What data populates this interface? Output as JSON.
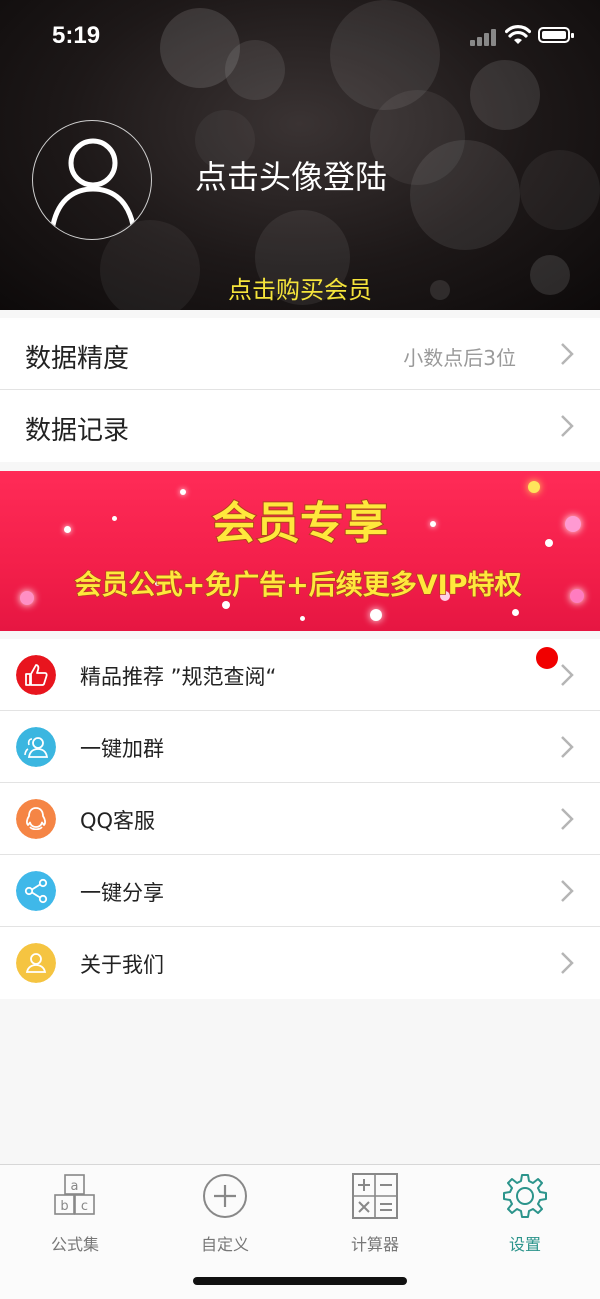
{
  "status_bar": {
    "time": "5:19"
  },
  "header": {
    "login_text": "点击头像登陆",
    "vip_link": "点击购买会员"
  },
  "settings": [
    {
      "label": "数据精度",
      "value": "小数点后3位"
    },
    {
      "label": "数据记录",
      "value": ""
    }
  ],
  "banner": {
    "title": "会员专享",
    "subtitle": "会员公式+免广告+后续更多VIP特权"
  },
  "menu": [
    {
      "label": "精品推荐 ”规范查阅“",
      "icon": "thumbs-up-icon",
      "color": "#e8151e",
      "has_badge": true
    },
    {
      "label": "一键加群",
      "icon": "group-icon",
      "color": "#3bb6e0",
      "has_badge": false
    },
    {
      "label": "QQ客服",
      "icon": "qq-icon",
      "color": "#f58545",
      "has_badge": false
    },
    {
      "label": "一键分享",
      "icon": "share-icon",
      "color": "#3fb8e9",
      "has_badge": false
    },
    {
      "label": "关于我们",
      "icon": "user-icon",
      "color": "#f5c441",
      "has_badge": false
    }
  ],
  "tabbar": {
    "tabs": [
      {
        "label": "公式集",
        "icon": "abc-blocks-icon",
        "active": false
      },
      {
        "label": "自定义",
        "icon": "plus-circle-icon",
        "active": false
      },
      {
        "label": "计算器",
        "icon": "calculator-icon",
        "active": false
      },
      {
        "label": "设置",
        "icon": "gear-icon",
        "active": true
      }
    ]
  },
  "colors": {
    "accent": "#2b948b",
    "vip_yellow": "#f5e43b",
    "banner_red": "#f31f4a",
    "badge_red": "#f10000"
  }
}
